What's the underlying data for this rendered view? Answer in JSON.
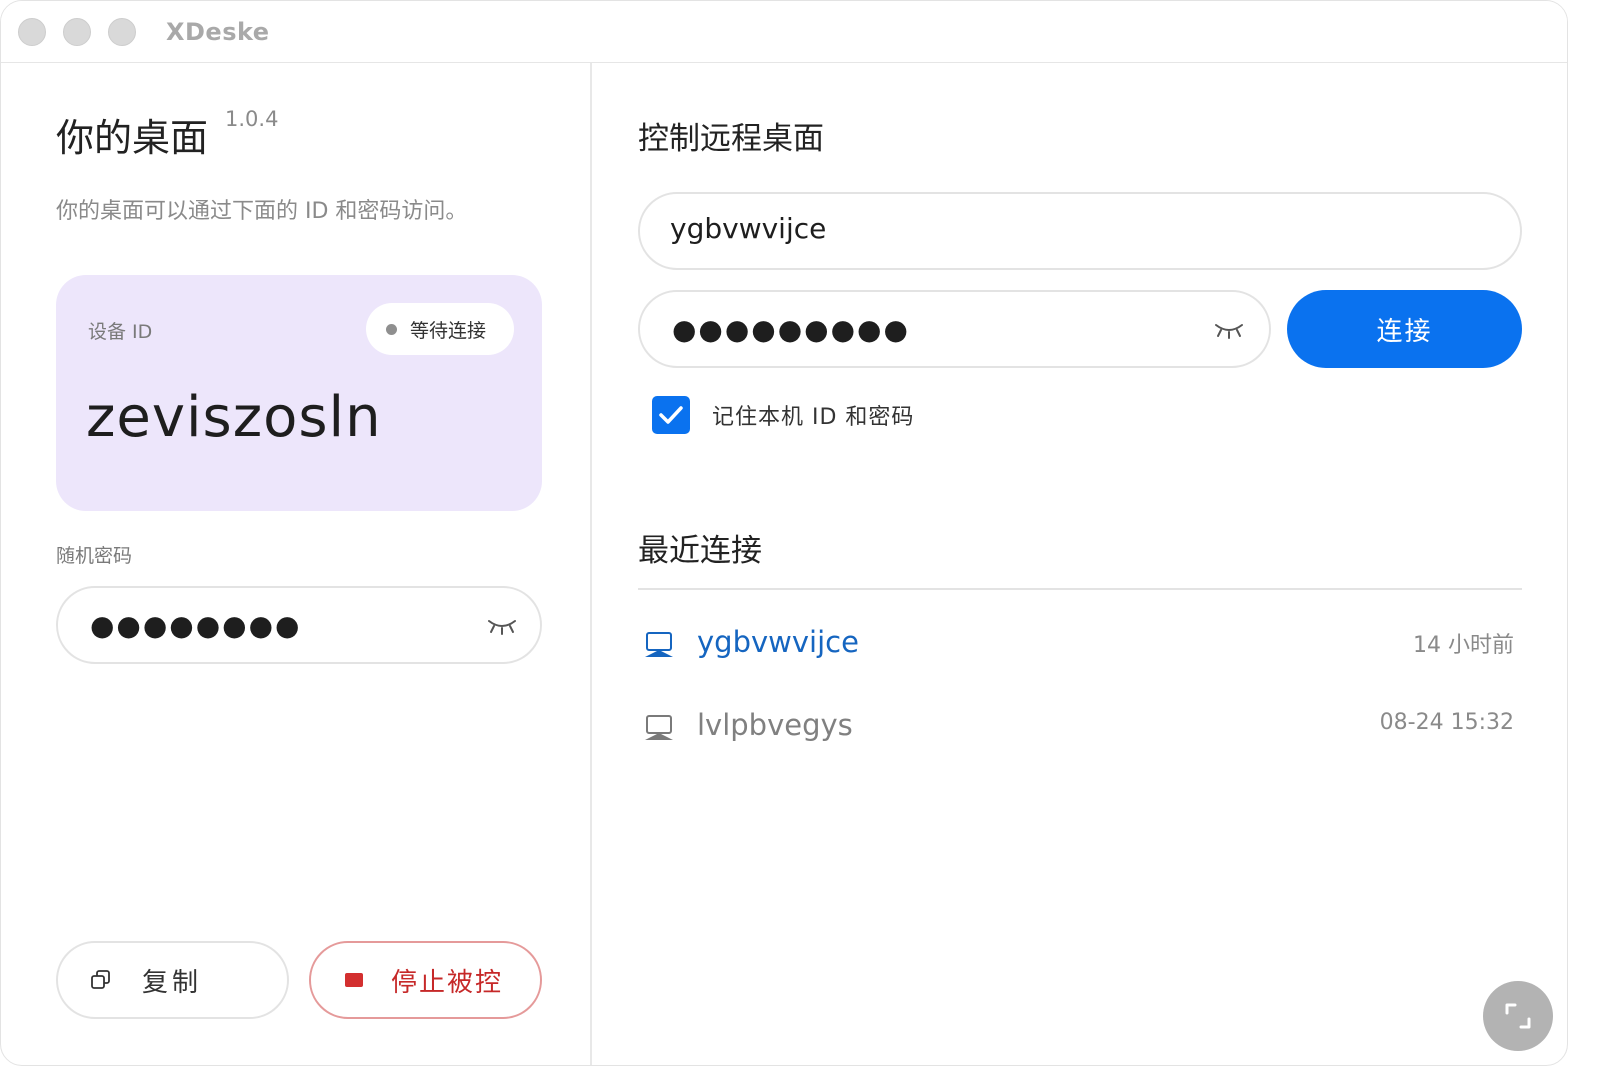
{
  "window": {
    "title": "XDeske"
  },
  "left": {
    "title": "你的桌面",
    "version": "1.0.4",
    "subtitle": "你的桌面可以通过下面的 ID 和密码访问。",
    "id_card": {
      "label": "设备 ID",
      "status": "等待连接",
      "device_id": "zeviszosln"
    },
    "password": {
      "label": "随机密码",
      "masked_value": "●●●●●●●●"
    },
    "copy_button": "复制",
    "stop_button": "停止被控"
  },
  "right": {
    "title": "控制远程桌面",
    "remote_id_value": "ygbvwvijce",
    "remote_password_masked": "●●●●●●●●●",
    "connect_button": "连接",
    "remember": {
      "label": "记住本机 ID 和密码",
      "checked": true
    },
    "recent": {
      "title": "最近连接",
      "items": [
        {
          "name": "ygbvwvijce",
          "time": "14 小时前",
          "active": true
        },
        {
          "name": "lvlpbvegys",
          "time": "08-24 15:32",
          "active": false
        }
      ]
    }
  },
  "colors": {
    "accent": "#0a72ef",
    "card": "#ede6fb",
    "stop": "#c62828",
    "link": "#1565c0"
  },
  "icons": [
    "eye-closed-icon",
    "copy-icon",
    "stop-icon",
    "check-icon",
    "monitor-icon",
    "expand-icon"
  ]
}
